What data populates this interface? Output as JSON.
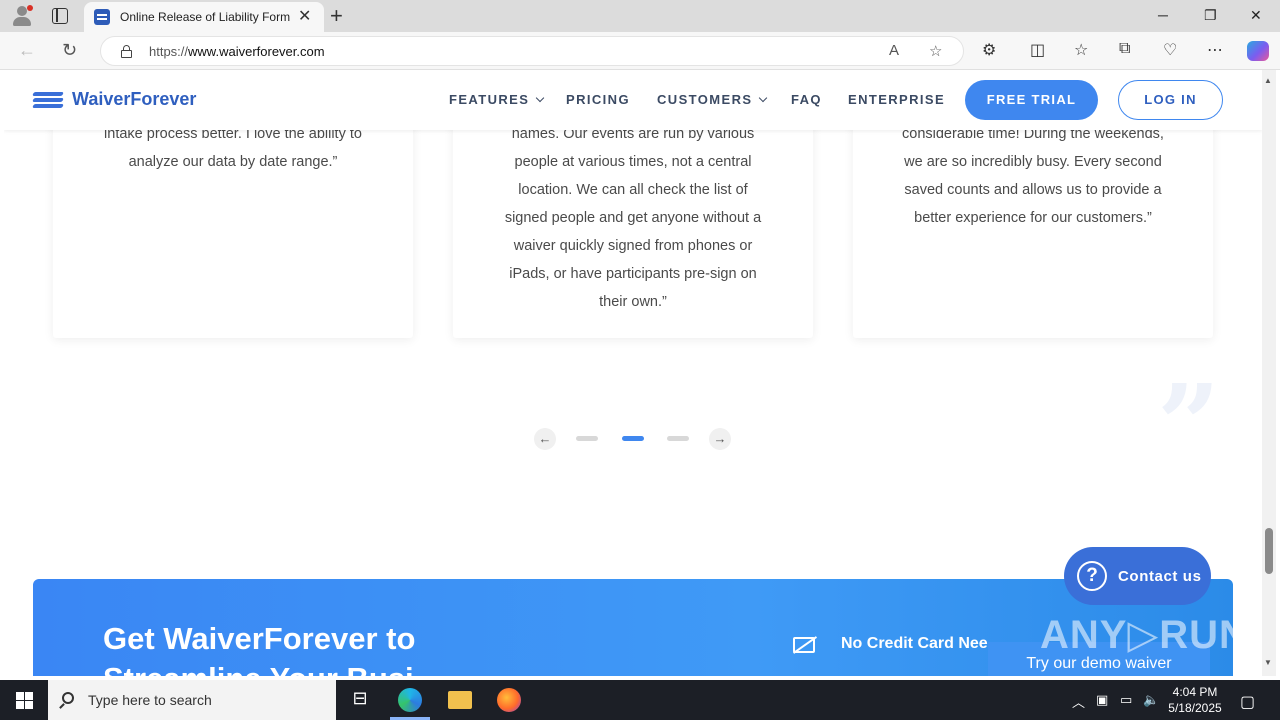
{
  "browser": {
    "tab_title": "Online Release of Liability Forms",
    "tab_close": "✕",
    "new_tab": "+",
    "url_prefix": "https://",
    "url_domain": "www.waiverforever.com",
    "minimize": "─",
    "restore": "❐",
    "close": "✕"
  },
  "site": {
    "logo": "WaiverForever",
    "menu": {
      "features": "FEATURES",
      "pricing": "PRICING",
      "customers": "CUSTOMERS",
      "faq": "FAQ",
      "enterprise": "ENTERPRISE"
    },
    "free_trial": "FREE TRIAL",
    "login": "LOG IN"
  },
  "testimonials": [
    {
      "lines": [
        "intake process better. I love the ability to",
        "analyze our data by date range.”"
      ]
    },
    {
      "lines": [
        "names. Our events are run by various",
        "people at various times, not a central",
        "location. We can all check the list of",
        "signed people and get anyone without a",
        "waiver quickly signed from phones or",
        "iPads, or have participants pre-sign on",
        "their own.”"
      ]
    },
    {
      "lines": [
        "considerable time! During the weekends,",
        "we are so incredibly busy. Every second",
        "saved counts and allows us to provide a",
        "better experience for our customers.”"
      ]
    }
  ],
  "carousel": {
    "prev": "←",
    "next": "→",
    "active_index": 1,
    "count": 3
  },
  "cta": {
    "title": "Get WaiverForever to",
    "title_line2": "Streamline Your Busi",
    "no_credit_card": "No Credit Card Nee",
    "demo": "Try our demo waiver"
  },
  "contact": {
    "icon": "?",
    "label": "Contact us"
  },
  "watermark": "ANY▷RUN",
  "taskbar": {
    "search_placeholder": "Type here to search",
    "time": "4:04 PM",
    "date": "5/18/2025"
  }
}
